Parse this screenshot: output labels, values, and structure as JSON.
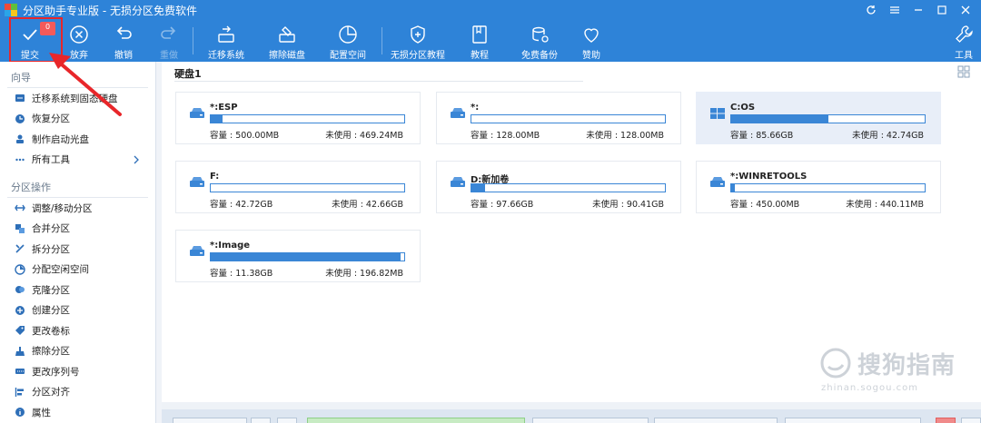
{
  "window": {
    "title": "分区助手专业版 - 无损分区免费软件"
  },
  "toolbar": {
    "badge": "0",
    "buttons": [
      {
        "id": "commit",
        "label": "提交",
        "icon": "check-icon",
        "enabled": true
      },
      {
        "id": "discard",
        "label": "放弃",
        "icon": "cancel-circle-icon",
        "enabled": true
      },
      {
        "id": "undo",
        "label": "撤销",
        "icon": "undo-icon",
        "enabled": true
      },
      {
        "id": "redo",
        "label": "重做",
        "icon": "redo-icon",
        "enabled": false
      },
      {
        "id": "migrate",
        "label": "迁移系统",
        "icon": "migrate-os-icon",
        "enabled": true
      },
      {
        "id": "wipe",
        "label": "擦除磁盘",
        "icon": "wipe-disk-icon",
        "enabled": true
      },
      {
        "id": "allocate",
        "label": "配置空间",
        "icon": "pie-chart-icon",
        "enabled": true
      },
      {
        "id": "tutorial",
        "label": "无损分区教程",
        "icon": "shield-icon",
        "enabled": true
      },
      {
        "id": "guide",
        "label": "教程",
        "icon": "book-icon",
        "enabled": true
      },
      {
        "id": "backup",
        "label": "免费备份",
        "icon": "backup-icon",
        "enabled": true
      },
      {
        "id": "donate",
        "label": "赞助",
        "icon": "heart-icon",
        "enabled": true
      },
      {
        "id": "tools",
        "label": "工具",
        "icon": "wrench-icon",
        "enabled": true
      }
    ]
  },
  "sidebar": {
    "wizard_title": "向导",
    "wizard_items": [
      {
        "label": "迁移系统到固态硬盘",
        "icon": "ssd-migrate-icon"
      },
      {
        "label": "恢复分区",
        "icon": "recover-icon"
      },
      {
        "label": "制作启动光盘",
        "icon": "boot-disc-icon"
      },
      {
        "label": "所有工具",
        "icon": "more-icon"
      }
    ],
    "ops_title": "分区操作",
    "ops_items": [
      {
        "label": "调整/移动分区",
        "icon": "resize-icon"
      },
      {
        "label": "合并分区",
        "icon": "merge-icon"
      },
      {
        "label": "拆分分区",
        "icon": "split-icon"
      },
      {
        "label": "分配空闲空间",
        "icon": "allocate-icon"
      },
      {
        "label": "克隆分区",
        "icon": "clone-icon"
      },
      {
        "label": "创建分区",
        "icon": "create-icon"
      },
      {
        "label": "更改卷标",
        "icon": "label-icon"
      },
      {
        "label": "擦除分区",
        "icon": "wipe-icon"
      },
      {
        "label": "更改序列号",
        "icon": "serial-icon"
      },
      {
        "label": "分区对齐",
        "icon": "align-icon"
      },
      {
        "label": "属性",
        "icon": "info-icon"
      }
    ]
  },
  "main": {
    "disk_title": "硬盘1",
    "capacity_label": "容量 :",
    "free_label": "未使用 :",
    "partitions": [
      {
        "name": "*:ESP",
        "capacity": "500.00MB",
        "free": "469.24MB",
        "used_fraction": 0.06,
        "icon": "drive-icon"
      },
      {
        "name": "*:",
        "capacity": "128.00MB",
        "free": "128.00MB",
        "used_fraction": 0.0,
        "icon": "drive-icon"
      },
      {
        "name": "C:OS",
        "capacity": "85.66GB",
        "free": "42.74GB",
        "used_fraction": 0.5,
        "icon": "windows-icon",
        "selected": true
      },
      {
        "name": "F:",
        "capacity": "42.72GB",
        "free": "42.66GB",
        "used_fraction": 0.0,
        "icon": "drive-icon"
      },
      {
        "name": "D:新加卷",
        "capacity": "97.66GB",
        "free": "90.41GB",
        "used_fraction": 0.07,
        "icon": "drive-icon"
      },
      {
        "name": "*:WINRETOOLS",
        "capacity": "450.00MB",
        "free": "440.11MB",
        "used_fraction": 0.02,
        "icon": "drive-icon"
      },
      {
        "name": "*:Image",
        "capacity": "11.38GB",
        "free": "196.82MB",
        "used_fraction": 0.98,
        "icon": "drive-icon"
      }
    ]
  },
  "watermark": {
    "text": "搜狗指南",
    "url": "zhinan.sogou.com"
  },
  "colors": {
    "toolbar": "#2e83d8",
    "accent": "#3a86d6",
    "highlight": "#e8262a"
  }
}
